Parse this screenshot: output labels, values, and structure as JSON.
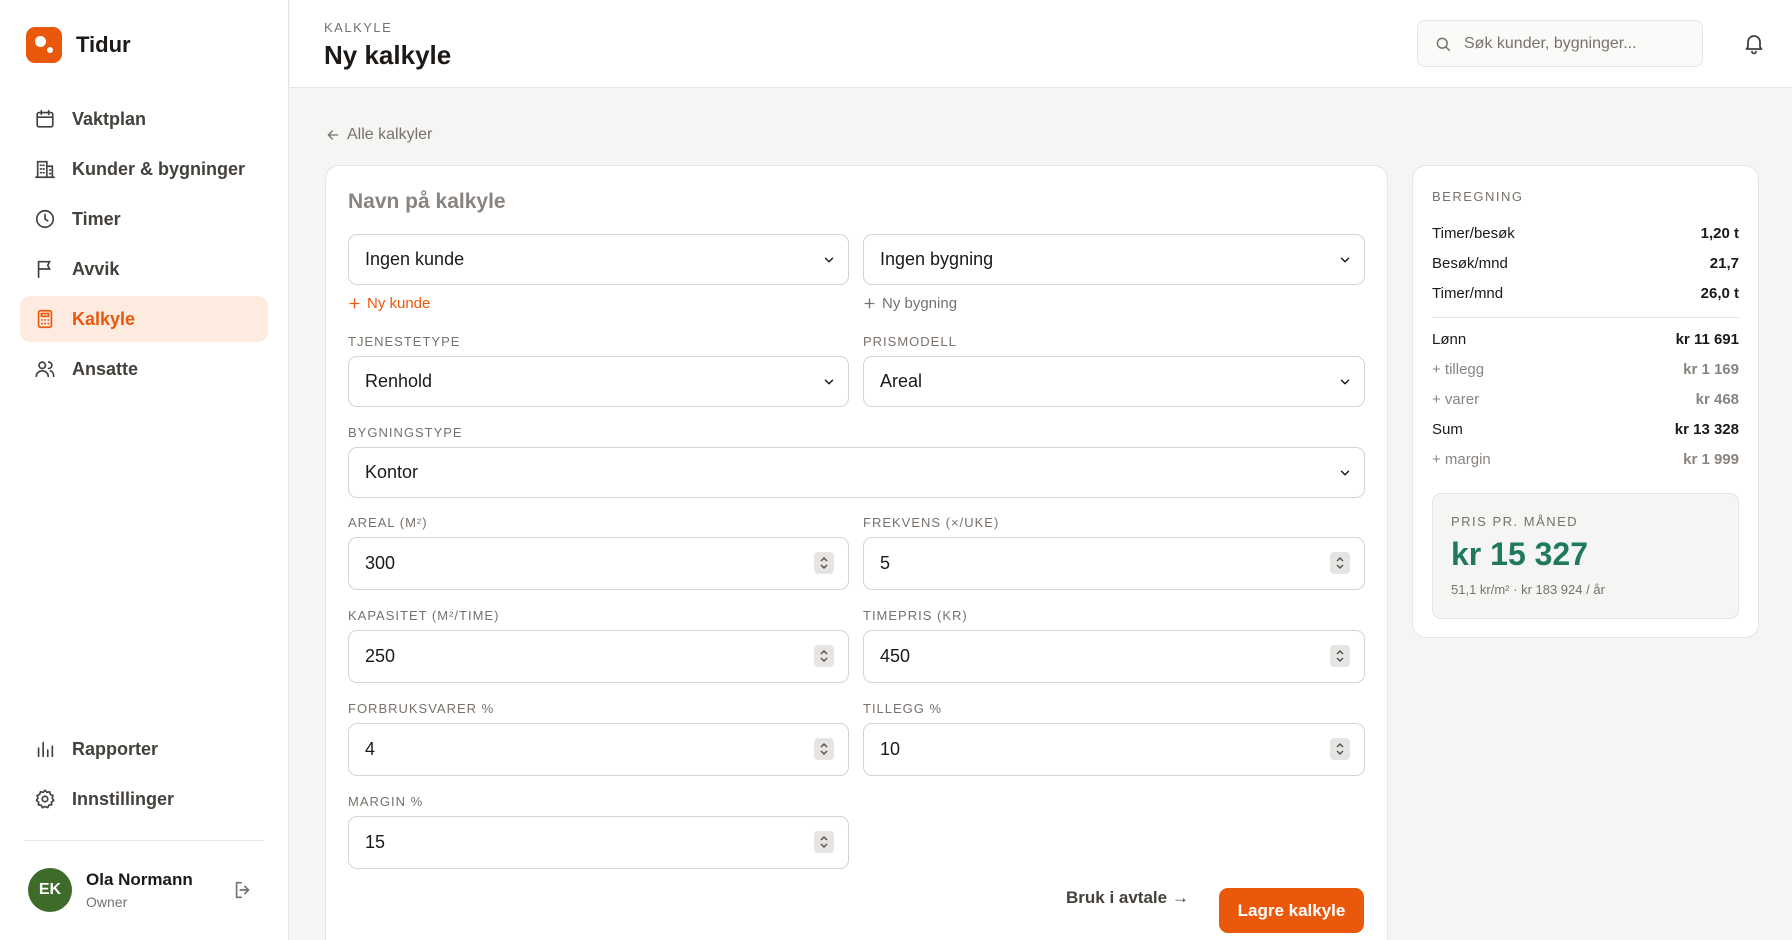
{
  "brand": {
    "name": "Tidur",
    "color": "#ea580c"
  },
  "nav": {
    "items": [
      {
        "label": "Vaktplan",
        "icon": "calendar-icon"
      },
      {
        "label": "Kunder & bygninger",
        "icon": "building-icon"
      },
      {
        "label": "Timer",
        "icon": "clock-icon"
      },
      {
        "label": "Avvik",
        "icon": "flag-icon"
      },
      {
        "label": "Kalkyle",
        "icon": "calculator-icon",
        "active": true
      },
      {
        "label": "Ansatte",
        "icon": "users-icon"
      }
    ],
    "bottom": [
      {
        "label": "Rapporter",
        "icon": "bar-chart-icon"
      },
      {
        "label": "Innstillinger",
        "icon": "gear-icon"
      }
    ]
  },
  "user": {
    "initials": "EK",
    "name": "Ola Normann",
    "role": "Owner"
  },
  "header": {
    "eyebrow": "KALKYLE",
    "title": "Ny kalkyle",
    "search_placeholder": "Søk kunder, bygninger..."
  },
  "breadcrumb": {
    "back_label": "Alle kalkyler"
  },
  "form": {
    "name_placeholder": "Navn på kalkyle",
    "customer": "Ingen kunde",
    "building": "Ingen bygning",
    "new_customer": "Ny kunde",
    "new_building": "Ny bygning",
    "service_type_label": "TJENESTETYPE",
    "service_type": "Renhold",
    "price_model_label": "PRISMODELL",
    "price_model": "Areal",
    "building_type_label": "BYGNINGSTYPE",
    "building_type": "Kontor",
    "area_label": "AREAL (M²)",
    "area": "300",
    "frequency_label": "FREKVENS (×/UKE)",
    "frequency": "5",
    "capacity_label": "KAPASITET (M²/TIME)",
    "capacity": "250",
    "hourly_rate_label": "TIMEPRIS (KR)",
    "hourly_rate": "450",
    "consumables_label": "FORBRUKSVARER %",
    "consumables": "4",
    "surcharge_label": "TILLEGG %",
    "surcharge": "10",
    "margin_label": "MARGIN %",
    "margin": "15",
    "use_in_agreement": "Bruk i avtale →",
    "save": "Lagre kalkyle"
  },
  "summary": {
    "title": "BEREGNING",
    "rows": [
      {
        "label": "Timer/besøk",
        "value": "1,20 t"
      },
      {
        "label": "Besøk/mnd",
        "value": "21,7"
      },
      {
        "label": "Timer/mnd",
        "value": "26,0 t"
      },
      {
        "label": "Lønn",
        "value": "kr 11 691"
      },
      {
        "label": "+ tillegg",
        "value": "kr 1 169"
      },
      {
        "label": "+ varer",
        "value": "kr 468"
      },
      {
        "label": "Sum",
        "value": "kr 13 328"
      },
      {
        "label": "+ margin",
        "value": "kr 1 999"
      }
    ],
    "price_label": "PRIS PR. MÅNED",
    "price_value": "kr 15 327",
    "price_sub": "51,1 kr/m² · kr 183 924 / år",
    "price_color": "#1f7a5a"
  }
}
